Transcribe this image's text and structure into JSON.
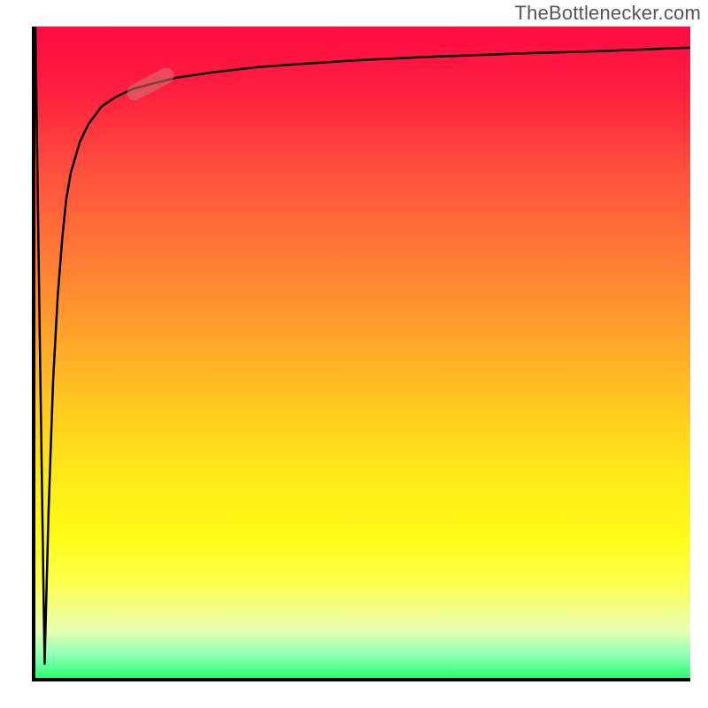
{
  "attribution": "TheBottlenecker.com",
  "colors": {
    "gradient_top": "#ff0b42",
    "gradient_mid": "#ffe818",
    "gradient_bottom": "#19ff66",
    "axis": "#000000",
    "curve": "#000000",
    "marker": "rgba(210,120,120,0.55)"
  },
  "chart_data": {
    "type": "line",
    "title": "",
    "xlabel": "",
    "ylabel": "",
    "xlim": [
      0,
      100
    ],
    "ylim": [
      0,
      100
    ],
    "background": "vertical-gradient red→yellow→green",
    "series": [
      {
        "name": "curve",
        "x": [
          0.0,
          0.7,
          1.4,
          2.0,
          2.7,
          3.4,
          4.1,
          4.7,
          5.4,
          6.8,
          8.1,
          10.1,
          12.2,
          14.9,
          17.6,
          21.6,
          27.0,
          33.8,
          40.5,
          50.0,
          60.8,
          74.3,
          87.8,
          100.0
        ],
        "y": [
          99.9,
          50.0,
          2.7,
          25.7,
          45.9,
          58.8,
          67.6,
          73.6,
          77.7,
          82.4,
          85.1,
          87.8,
          89.2,
          90.5,
          91.2,
          92.2,
          93.0,
          93.8,
          94.3,
          94.9,
          95.4,
          95.9,
          96.3,
          96.8
        ],
        "note": "y values are percent of plot height from bottom; the curve dips sharply to near-bottom around x≈1.4 then rises steeply and asymptotes near the top"
      }
    ],
    "marker": {
      "center_x": 17.6,
      "center_y": 91.2,
      "rotation_deg": -28
    }
  }
}
